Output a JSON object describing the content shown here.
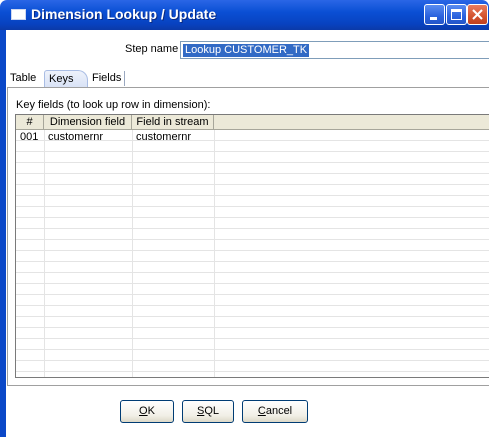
{
  "window": {
    "title": "Dimension Lookup / Update",
    "title_bar_color": "#0a4fd4"
  },
  "form": {
    "step_name_label": "Step name",
    "step_name_value": "Lookup CUSTOMER_TK"
  },
  "tabs": [
    {
      "label": "Table",
      "active": false
    },
    {
      "label": "Keys",
      "active": true
    },
    {
      "label": "Fields",
      "active": false
    }
  ],
  "keys": {
    "description": "Key fields (to look up row in dimension):",
    "columns": [
      "#",
      "Dimension field",
      "Field in stream"
    ],
    "rows": [
      [
        "001",
        "customernr",
        "customernr"
      ]
    ]
  },
  "buttons": {
    "ok": {
      "mnemonic": "O",
      "rest": "K"
    },
    "sql": {
      "mnemonic": "S",
      "rest": "QL"
    },
    "cancel": {
      "mnemonic": "C",
      "rest": "ancel"
    }
  },
  "icons": {
    "window_icon": "window-icon",
    "minimize": "minimize-icon",
    "maximize": "maximize-icon",
    "close": "close-icon"
  }
}
